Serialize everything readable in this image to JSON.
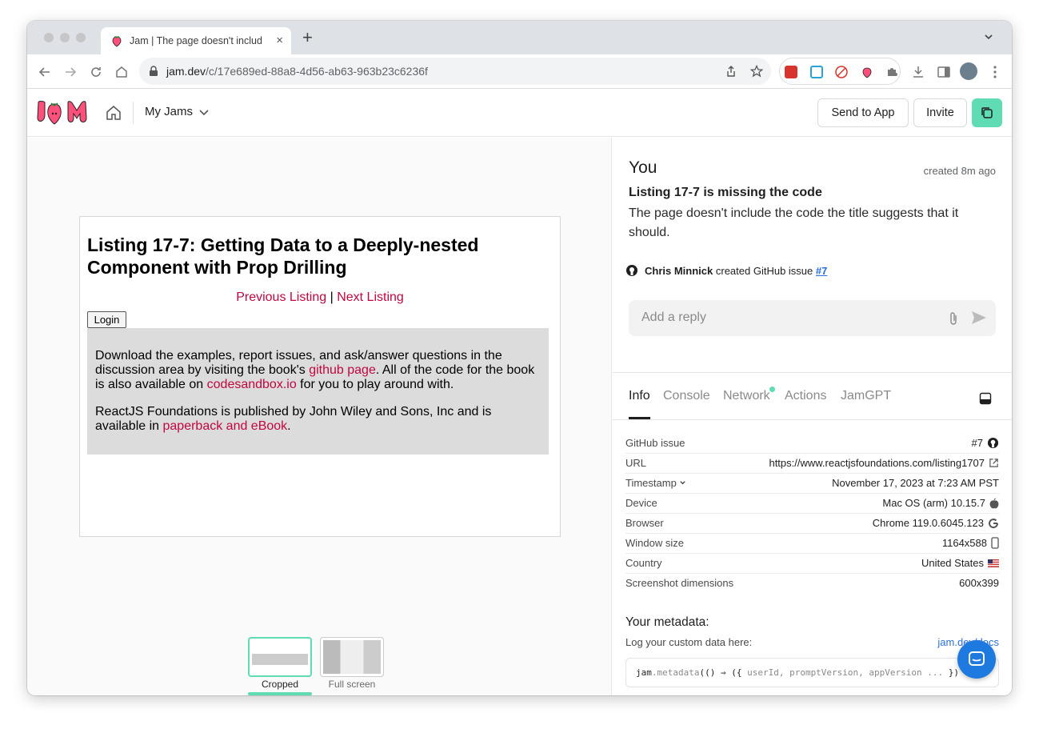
{
  "browser": {
    "tab_title": "Jam | The page doesn't include",
    "tab_close": "×",
    "new_tab": "+",
    "url_host": "jam.dev",
    "url_path": "/c/17e689ed-88a8-4d56-ab63-963b23c6236f"
  },
  "app": {
    "my_jams_label": "My Jams",
    "send_to_app_label": "Send to App",
    "invite_label": "Invite"
  },
  "screenshot_content": {
    "heading": "Listing 17-7: Getting Data to a Deeply-nested Component with Prop Drilling",
    "prev_link": "Previous Listing",
    "separator": " | ",
    "next_link": "Next Listing",
    "login_label": "Login",
    "para1_a": "Download the examples, report issues, and ask/answer questions in the discussion area by visiting the book's ",
    "para1_link1": "github page",
    "para1_b": ". All of the code for the book is also available on ",
    "para1_link2": "codesandbox.io",
    "para1_c": " for you to play around with.",
    "para2_a": "ReactJS Foundations is published by John Wiley and Sons, Inc and is available in ",
    "para2_link": "paperback and eBook",
    "para2_b": "."
  },
  "thumbnails": {
    "cropped_label": "Cropped",
    "fullscreen_label": "Full screen"
  },
  "issue": {
    "author": "You",
    "created": "created 8m ago",
    "title": "Listing 17-7 is missing the code",
    "description": "The page doesn't include the code the title suggests that it should.",
    "gh_user": "Chris Minnick",
    "gh_text": "created GitHub issue",
    "gh_issue": "#7",
    "reply_placeholder": "Add a reply"
  },
  "tabs": {
    "info": "Info",
    "console": "Console",
    "network": "Network",
    "actions": "Actions",
    "jamgpt": "JamGPT"
  },
  "info": {
    "github_issue_k": "GitHub issue",
    "github_issue_v": "#7",
    "url_k": "URL",
    "url_v": "https://www.reactjsfoundations.com/listing1707",
    "timestamp_k": "Timestamp",
    "timestamp_v": "November 17, 2023 at 7:23 AM PST",
    "device_k": "Device",
    "device_v": "Mac OS (arm) 10.15.7",
    "browser_k": "Browser",
    "browser_v": "Chrome 119.0.6045.123",
    "window_k": "Window size",
    "window_v": "1164x588",
    "country_k": "Country",
    "country_v": "United States",
    "dims_k": "Screenshot dimensions",
    "dims_v": "600x399"
  },
  "metadata": {
    "heading": "Your metadata:",
    "sub": "Log your custom data here:",
    "link": "jam.dev/docs",
    "code_a": "jam",
    "code_b": ".metadata",
    "code_c": "(() ⇒ ({ ",
    "code_d": "userId, promptVersion, appVersion ...",
    "code_e": " })"
  },
  "colors": {
    "accent_green": "#5fdcb4",
    "link_red": "#c1073f",
    "link_blue": "#2a6fdb"
  }
}
